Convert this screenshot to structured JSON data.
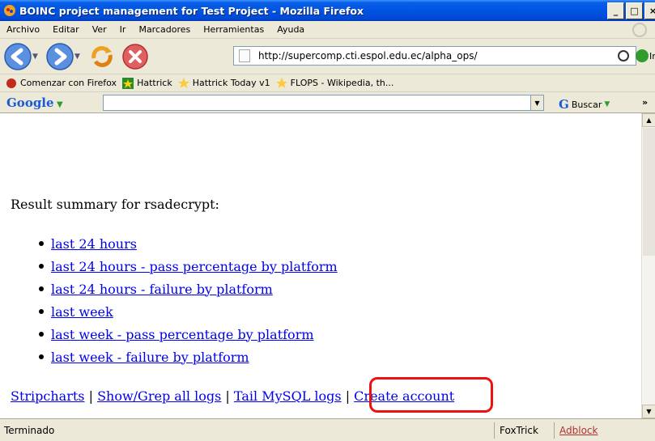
{
  "window": {
    "title": "BOINC project management for Test Project - Mozilla Firefox",
    "buttons": [
      "_",
      "□",
      "×"
    ]
  },
  "menu": [
    "Archivo",
    "Editar",
    "Ver",
    "Ir",
    "Marcadores",
    "Herramientas",
    "Ayuda"
  ],
  "nav": {
    "url": "http://supercomp.cti.espol.edu.ec/alpha_ops/",
    "go_label": "Ir"
  },
  "bookmarks": [
    "Comenzar con Firefox",
    "Hattrick",
    "Hattrick Today v1",
    "FLOPS - Wikipedia, th..."
  ],
  "google_bar": {
    "logo": "Google",
    "search_value": "",
    "buscar_label": "Buscar",
    "more_label": "»"
  },
  "content": {
    "summary": "Result summary for rsadecrypt:",
    "links": [
      "last 24 hours",
      "last 24 hours - pass percentage by platform",
      "last 24 hours - failure by platform",
      "last week",
      "last week - pass percentage by platform",
      "last week - failure by platform"
    ],
    "footer_links": [
      "Stripcharts",
      "Show/Grep all logs",
      "Tail MySQL logs",
      "Create account"
    ],
    "separator": " | "
  },
  "status": {
    "text": "Terminado",
    "foxtrick": "FoxTrick",
    "adblock": "Adblock"
  },
  "colors": {
    "link": "#0000ee",
    "highlight": "#e11111",
    "titlebar": "#0054e3"
  }
}
